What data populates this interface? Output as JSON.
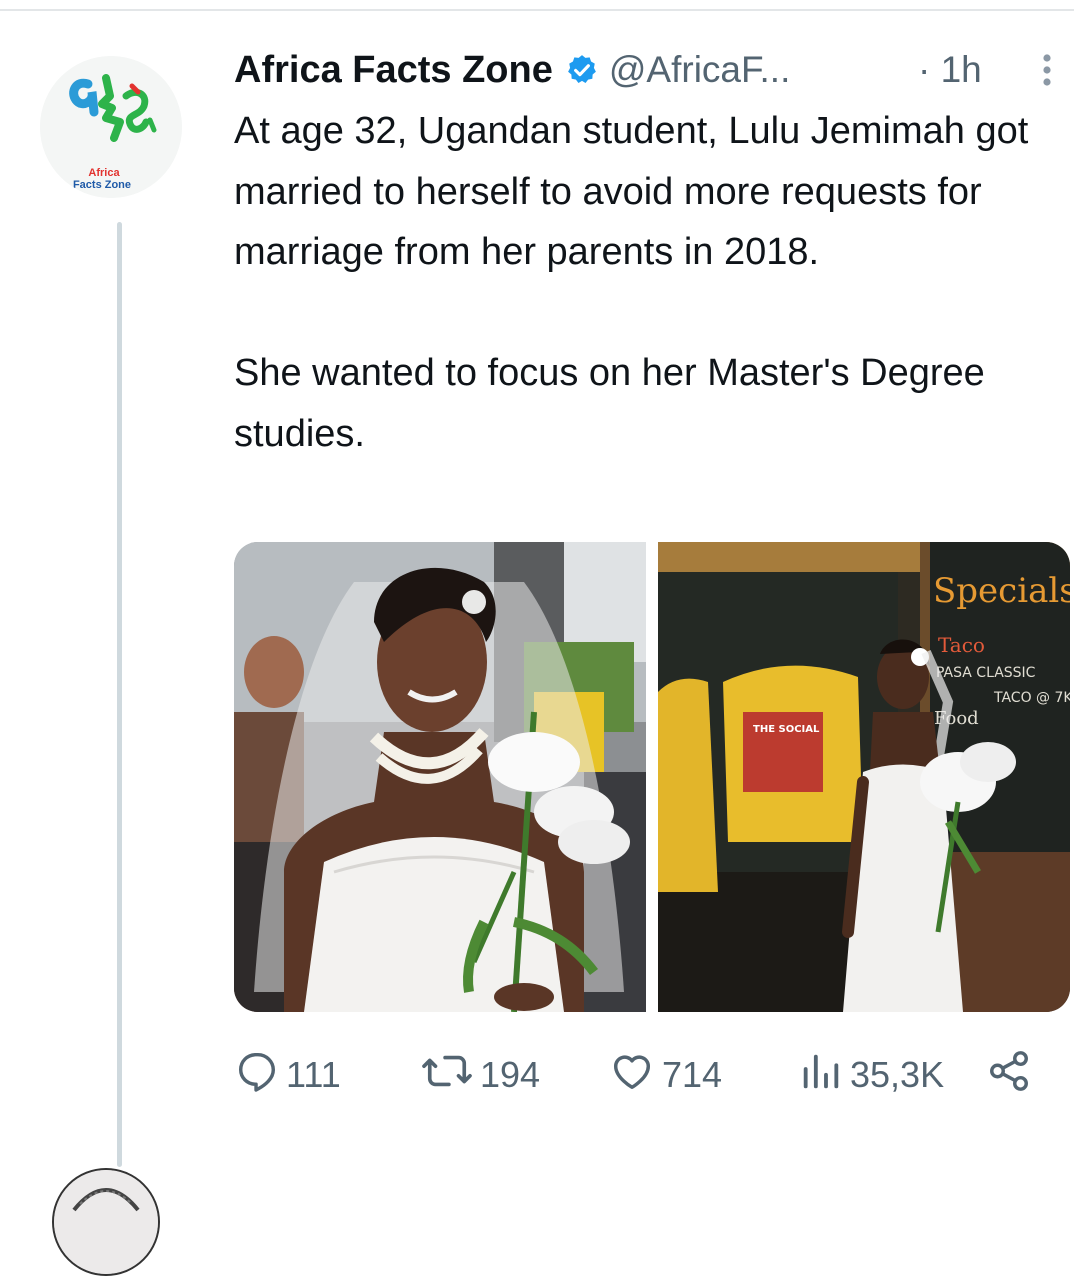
{
  "tweet": {
    "author": {
      "name": "Africa Facts Zone",
      "handle": "@AfricaF...",
      "verified": true,
      "avatar_lines": [
        "Africa",
        "Facts Zone"
      ]
    },
    "time": "· 1h",
    "text": "At age 32, Ugandan student, Lulu Jemimah got married to herself to avoid more requests for marriage from her parents in 2018.\n\nShe wanted to focus on her Master's Degree studies.",
    "media": {
      "image_2_sign": {
        "specials": "Specials",
        "menu_line1": "Taco",
        "menu_line2": "PASA  CLASSIC",
        "menu_line3": "TACO @ 7K",
        "menu_line4": "Food",
        "poster": "THE SOCIAL"
      }
    },
    "stats": {
      "replies": "111",
      "retweets": "194",
      "likes": "714",
      "views": "35,3K"
    }
  },
  "colors": {
    "text": "#0f1419",
    "secondary": "#536471",
    "verified": "#1d9bf0",
    "divider": "#cfd9de"
  }
}
